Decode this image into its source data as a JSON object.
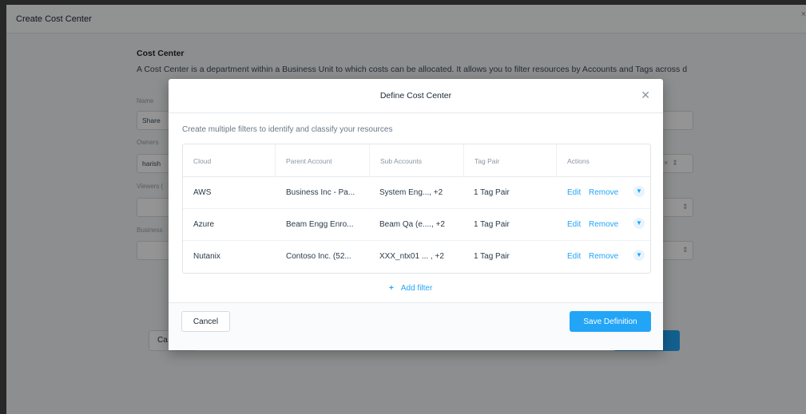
{
  "page": {
    "title": "Create Cost Center",
    "close_label": "×",
    "section_heading": "Cost Center",
    "section_description": "A Cost Center is a department within a Business Unit to which costs can be allocated. It allows you to filter resources by Accounts and Tags across d",
    "fields": [
      {
        "label": "Name",
        "value": "Share"
      },
      {
        "label": "Owners",
        "value": "harish"
      },
      {
        "label": "Viewers (",
        "value": ""
      },
      {
        "label": "Business",
        "value": ""
      }
    ],
    "footer_button_partial": "Ca"
  },
  "modal": {
    "title": "Define Cost Center",
    "subtitle": "Create multiple filters to identify and classify your resources",
    "columns": [
      "Cloud",
      "Parent Account",
      "Sub Accounts",
      "Tag Pair",
      "Actions"
    ],
    "rows": [
      {
        "cloud": "AWS",
        "parent": "Business Inc - Pa...",
        "sub": "System Eng..., +2",
        "tag": "1 Tag Pair",
        "edit": "Edit",
        "remove": "Remove"
      },
      {
        "cloud": "Azure",
        "parent": "Beam Engg Enro...",
        "sub": "Beam Qa (e...., +2",
        "tag": "1 Tag Pair",
        "edit": "Edit",
        "remove": "Remove"
      },
      {
        "cloud": "Nutanix",
        "parent": "Contoso Inc. (52...",
        "sub": "XXX_ntx01 ... , +2",
        "tag": "1 Tag Pair",
        "edit": "Edit",
        "remove": "Remove"
      }
    ],
    "add_filter_label": "Add filter",
    "cancel_label": "Cancel",
    "save_label": "Save Definition"
  },
  "colors": {
    "accent": "#22a5f7",
    "overlay": "rgba(0,0,0,0.42)"
  }
}
